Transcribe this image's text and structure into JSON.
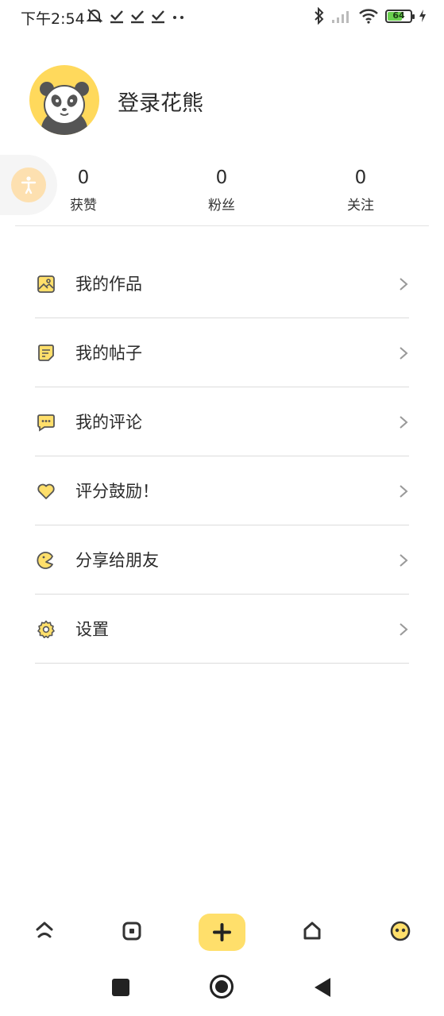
{
  "status_bar": {
    "time": "下午2:54",
    "battery_level": "64",
    "battery_fraction": 0.64,
    "battery_color": "#6ad14f"
  },
  "profile": {
    "avatar_icon": "panda-avatar",
    "login_text": "登录花熊"
  },
  "stats": [
    {
      "value": "0",
      "label": "获赞"
    },
    {
      "value": "0",
      "label": "粉丝"
    },
    {
      "value": "0",
      "label": "关注"
    }
  ],
  "menu": [
    {
      "label": "我的作品",
      "icon": "image-icon"
    },
    {
      "label": "我的帖子",
      "icon": "note-icon"
    },
    {
      "label": "我的评论",
      "icon": "comment-icon"
    },
    {
      "label": "评分鼓励！",
      "icon": "heart-icon"
    },
    {
      "label": "分享给朋友",
      "icon": "share-icon"
    },
    {
      "label": "设置",
      "icon": "gear-icon"
    }
  ],
  "tabbar": {
    "items": [
      "home-icon",
      "square-icon",
      "add-icon",
      "house-icon",
      "profile-face-icon"
    ],
    "accent": "#ffdf6b"
  },
  "theme": {
    "icon_fill": "#ffdf6b",
    "icon_stroke": "#555555",
    "avatar_bg": "#ffd95c"
  }
}
